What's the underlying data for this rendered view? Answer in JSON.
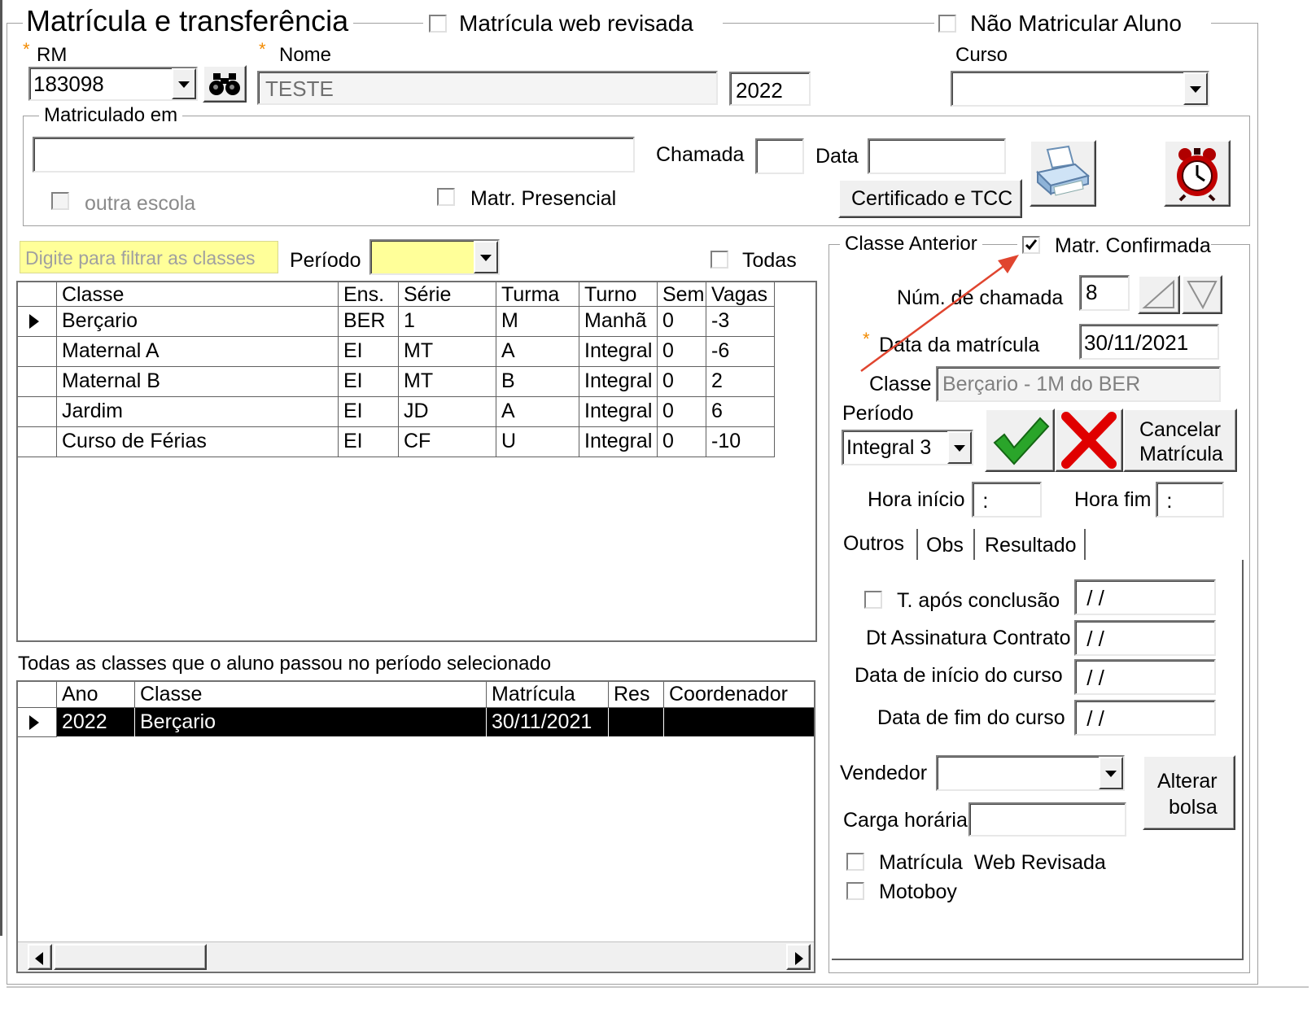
{
  "header": {
    "title": "Matrícula e transferência",
    "matricula_web_revisada_label": "Matrícula web revisada",
    "nao_matricular_label": "Não Matricular Aluno"
  },
  "aluno": {
    "required_mark": "*",
    "rm_label": "RM",
    "rm_value": "183098",
    "nome_label": "Nome",
    "nome_value": "TESTE",
    "ano_value": "2022",
    "curso_label": "Curso",
    "curso_value": ""
  },
  "matriculado_em": {
    "group_label": "Matriculado em",
    "escola_value": "",
    "chamada_label": "Chamada",
    "chamada_value": "",
    "data_label": "Data",
    "data_value": "",
    "outra_escola_label": "outra escola",
    "matr_presencial_label": "Matr. Presencial",
    "certificado_button": "Certificado e TCC"
  },
  "filter": {
    "placeholder": "Digite para filtrar as classes",
    "periodo_label": "Período",
    "periodo_value": "",
    "todas_label": "Todas"
  },
  "classes_table": {
    "columns": [
      "Classe",
      "Ens.",
      "Série",
      "Turma",
      "Turno",
      "Sem",
      "Vagas"
    ],
    "rows": [
      [
        "Berçario",
        "BER",
        "1",
        "M",
        "Manhã",
        "0",
        "-3"
      ],
      [
        "Maternal A",
        "EI",
        "MT",
        "A",
        "Integral",
        "0",
        "-6"
      ],
      [
        "Maternal B",
        "EI",
        "MT",
        "B",
        "Integral",
        "0",
        "2"
      ],
      [
        "Jardim",
        "EI",
        "JD",
        "A",
        "Integral",
        "0",
        "6"
      ],
      [
        "Curso de Férias",
        "EI",
        "CF",
        "U",
        "Integral",
        "0",
        "-10"
      ]
    ]
  },
  "history": {
    "caption": "Todas as classes que o aluno passou no período selecionado",
    "columns": [
      "Ano",
      "Classe",
      "Matrícula",
      "Res",
      "Coordenador"
    ],
    "rows": [
      [
        "2022",
        "Berçario",
        "30/11/2021",
        "",
        ""
      ]
    ]
  },
  "right_panel": {
    "group_label": "Classe Anterior",
    "matr_confirmada_label": "Matr. Confirmada",
    "matr_confirmada_checked": true,
    "num_chamada_label": "Núm. de chamada",
    "num_chamada_value": "8",
    "data_matricula_label": "Data da matrícula",
    "data_matricula_value": "30/11/2021",
    "classe_label": "Classe",
    "classe_value": "Berçario - 1M do BER",
    "periodo_label": "Período",
    "periodo_value": "Integral 3",
    "cancelar_label_line1": "Cancelar",
    "cancelar_label_line2": "Matrícula",
    "hora_inicio_label": "Hora início",
    "hora_inicio_value": " :",
    "hora_fim_label": "Hora fim",
    "hora_fim_value": " :",
    "tabs": [
      "Outros",
      "Obs",
      "Resultado"
    ],
    "t_apos_conclusao_label": "T. após conclusão",
    "t_apos_conclusao_value": " / /",
    "dt_assinatura_label": "Dt Assinatura Contrato",
    "dt_assinatura_value": " / /",
    "data_inicio_label": "Data de início do curso",
    "data_inicio_value": " / /",
    "data_fim_label": "Data de fim do curso",
    "data_fim_value": " / /",
    "vendedor_label": "Vendedor",
    "vendedor_value": "",
    "carga_horaria_label": "Carga horária",
    "carga_horaria_value": "",
    "alterar_bolsa_line1": "Alterar",
    "alterar_bolsa_line2": "bolsa",
    "matricula_web_revisada_label": "Matrícula  Web Revisada",
    "motoboy_label": "Motoboy"
  },
  "colors": {
    "filter_highlight": "#ffff99",
    "annotation_arrow": "#e0452f",
    "required_star": "#f28a00"
  }
}
